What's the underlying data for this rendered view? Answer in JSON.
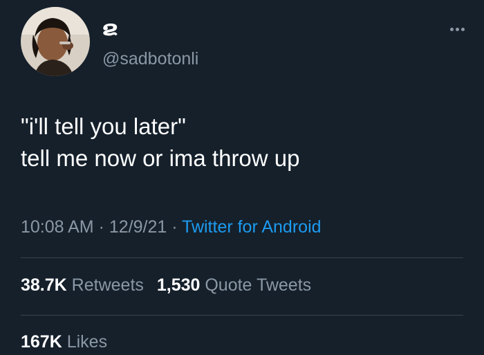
{
  "author": {
    "display_name": "ຂ",
    "handle": "@sadbotonli",
    "avatar_icon": "user-avatar-photo"
  },
  "tweet": {
    "line1": "\"i'll tell you later\"",
    "line2": "tell me now or ima throw up"
  },
  "meta": {
    "time": "10:08 AM",
    "sep1": " · ",
    "date": "12/9/21",
    "sep2": " · ",
    "source": "Twitter for Android"
  },
  "stats": {
    "retweets_count": "38.7K",
    "retweets_label": "Retweets",
    "quotes_count": "1,530",
    "quotes_label": "Quote Tweets",
    "likes_count": "167K",
    "likes_label": "Likes"
  },
  "colors": {
    "background": "#15202b",
    "text": "#ffffff",
    "secondary": "#8b98a5",
    "link": "#1d9bf0",
    "divider": "#38444d"
  }
}
